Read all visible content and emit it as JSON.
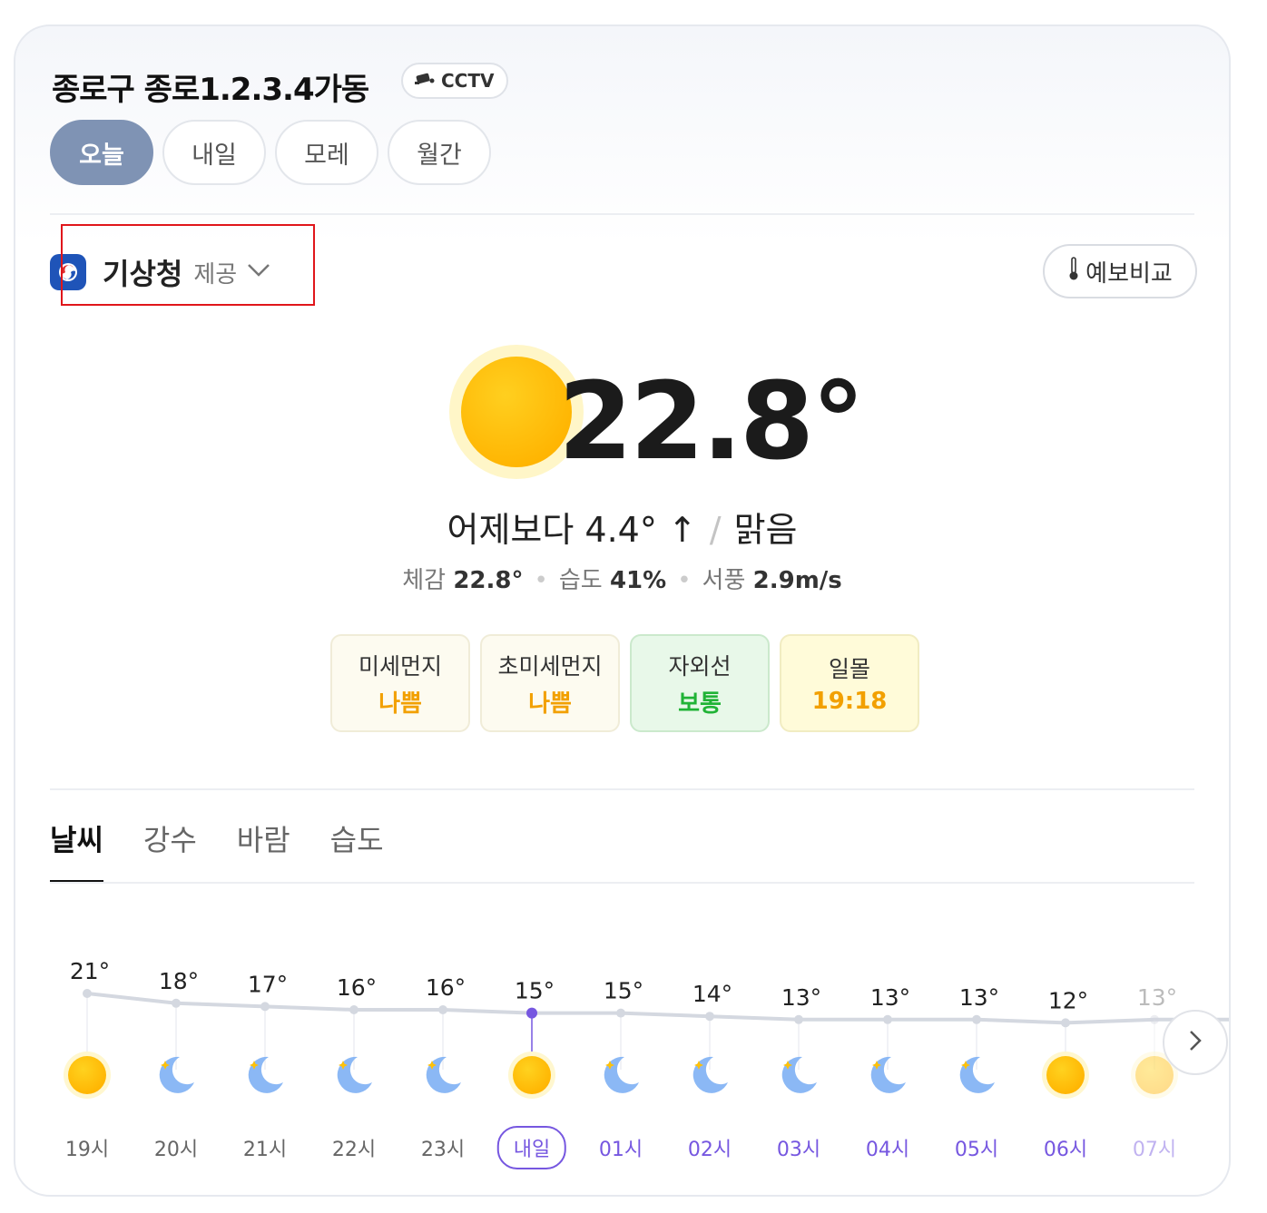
{
  "header": {
    "title": "종로구 종로1.2.3.4가동",
    "cctv_label": "CCTV"
  },
  "day_tabs": [
    {
      "label": "오늘",
      "active": true
    },
    {
      "label": "내일",
      "active": false
    },
    {
      "label": "모레",
      "active": false
    },
    {
      "label": "월간",
      "active": false
    }
  ],
  "provider": {
    "name": "기상청",
    "suffix": "제공"
  },
  "compare_button": "예보비교",
  "current": {
    "temperature": "22.8°",
    "compare_yesterday": "어제보다 4.4° ↑",
    "condition": "맑음",
    "feels_label": "체감",
    "feels_value": "22.8°",
    "humidity_label": "습도",
    "humidity_value": "41%",
    "wind_label": "서풍",
    "wind_value": "2.9m/s"
  },
  "chips": [
    {
      "label": "미세먼지",
      "value": "나쁨",
      "color": "#f2a000"
    },
    {
      "label": "초미세먼지",
      "value": "나쁨",
      "color": "#f2a000"
    },
    {
      "label": "자외선",
      "value": "보통",
      "color": "#20b336"
    },
    {
      "label": "일몰",
      "value": "19:18",
      "color": "#f2a000"
    }
  ],
  "sub_tabs": [
    {
      "label": "날씨",
      "active": true
    },
    {
      "label": "강수",
      "active": false
    },
    {
      "label": "바람",
      "active": false
    },
    {
      "label": "습도",
      "active": false
    }
  ],
  "hourly": [
    {
      "hour": "19시",
      "temp": 21,
      "icon": "sun-icon",
      "next_day": false
    },
    {
      "hour": "20시",
      "temp": 18,
      "icon": "moon-icon",
      "next_day": false
    },
    {
      "hour": "21시",
      "temp": 17,
      "icon": "moon-icon",
      "next_day": false
    },
    {
      "hour": "22시",
      "temp": 16,
      "icon": "moon-icon",
      "next_day": false
    },
    {
      "hour": "23시",
      "temp": 16,
      "icon": "moon-icon",
      "next_day": false
    },
    {
      "hour": "내일",
      "temp": 15,
      "icon": "sun-icon",
      "next_day": true,
      "badge": true
    },
    {
      "hour": "01시",
      "temp": 15,
      "icon": "moon-icon",
      "next_day": true
    },
    {
      "hour": "02시",
      "temp": 14,
      "icon": "moon-icon",
      "next_day": true
    },
    {
      "hour": "03시",
      "temp": 13,
      "icon": "moon-icon",
      "next_day": true
    },
    {
      "hour": "04시",
      "temp": 13,
      "icon": "moon-icon",
      "next_day": true
    },
    {
      "hour": "05시",
      "temp": 13,
      "icon": "moon-icon",
      "next_day": true
    },
    {
      "hour": "06시",
      "temp": 12,
      "icon": "sun-icon",
      "next_day": true
    },
    {
      "hour": "07시",
      "temp": 13,
      "icon": "sun-icon",
      "next_day": true,
      "faded": true
    }
  ],
  "colors": {
    "accent": "#7657e0",
    "active_tab": "#7f93b4",
    "sun": "#ffc107",
    "moon": "#8bb8f5"
  }
}
